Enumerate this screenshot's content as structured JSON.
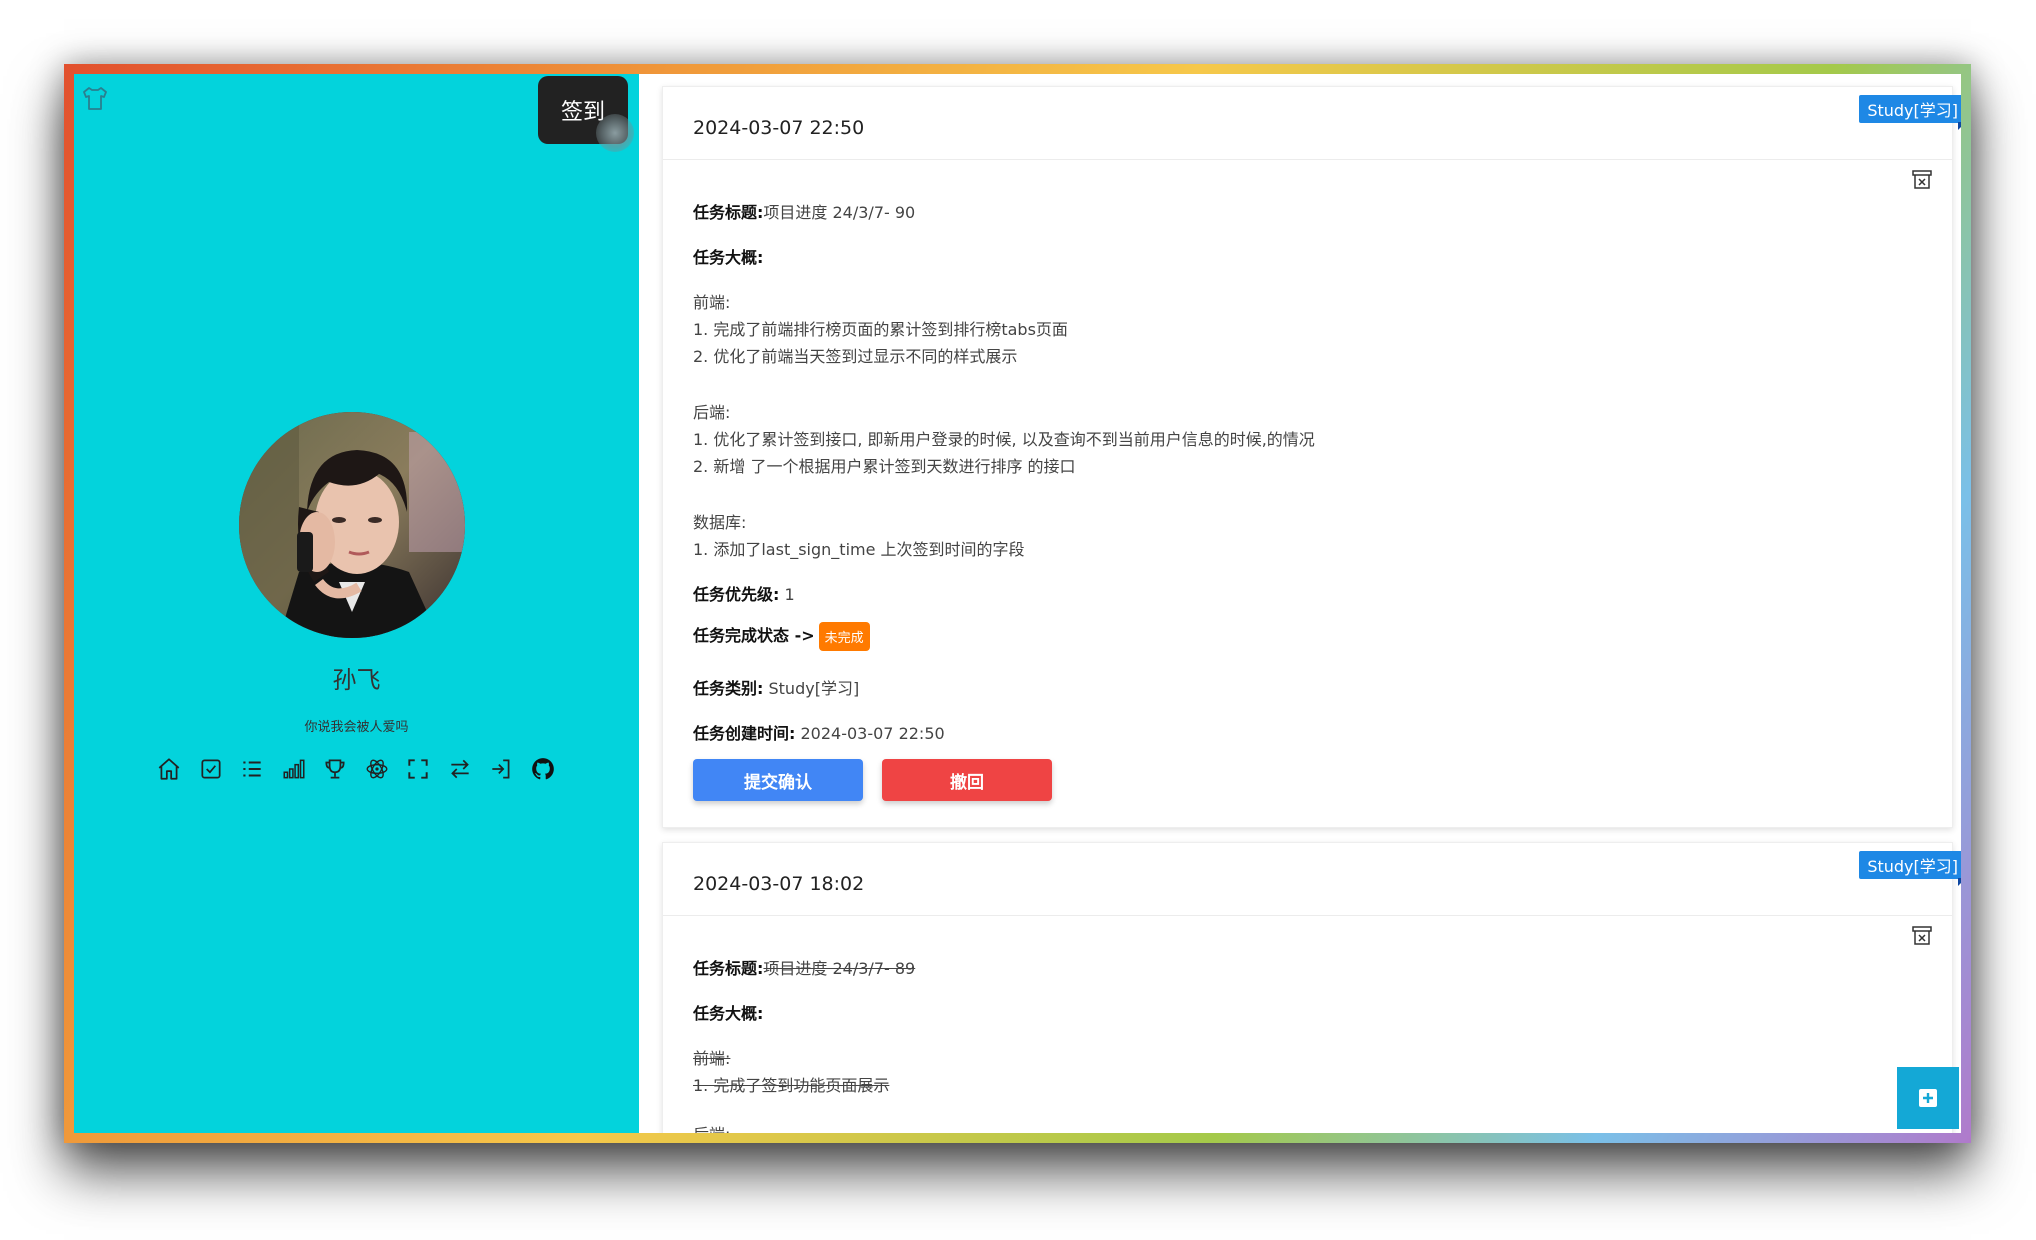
{
  "sidebar": {
    "signin_label": "签到",
    "username": "孙飞",
    "motto": "你说我会被人爱吗",
    "nav_icons": [
      "home-icon",
      "check-square-icon",
      "list-icon",
      "bar-chart-icon",
      "trophy-icon",
      "atom-icon",
      "fullscreen-icon",
      "swap-icon",
      "logout-icon",
      "github-icon"
    ]
  },
  "cards": [
    {
      "date": "2024-03-07 22:50",
      "tag": "Study[学习]",
      "title_label": "任务标题:",
      "title_value": "项目进度 24/3/7- 90",
      "summary_label": "任务大概:",
      "lines": [
        "前端:",
        "1. 完成了前端排行榜页面的累计签到排行榜tabs页面",
        "2. 优化了前端当天签到过显示不同的样式展示",
        "后端:",
        "1. 优化了累计签到接口, 即新用户登录的时候, 以及查询不到当前用户信息的时候,的情况",
        "2. 新增 了一个根据用户累计签到天数进行排序 的接口",
        "数据库:",
        "1. 添加了last_sign_time 上次签到时间的字段"
      ],
      "priority_label": "任务优先级:",
      "priority_value": "1",
      "status_label": "任务完成状态 ->",
      "status_value": "未完成",
      "category_label": "任务类别:",
      "category_value": "Study[学习]",
      "created_label": "任务创建时间:",
      "created_value": "2024-03-07 22:50",
      "confirm_label": "提交确认",
      "revoke_label": "撤回"
    },
    {
      "date": "2024-03-07 18:02",
      "tag": "Study[学习]",
      "title_label": "任务标题:",
      "title_value": "项目进度 24/3/7- 89",
      "summary_label": "任务大概:",
      "lines": [
        "前端:",
        "1. 完成了签到功能页面展示",
        "后端:"
      ]
    }
  ],
  "colors": {
    "sidebar_bg": "#03d3dc",
    "confirm": "#4186f5",
    "revoke": "#ef4444",
    "tag": "#1e88e5",
    "badge": "#ff7a00",
    "fab": "#14a8d6"
  }
}
